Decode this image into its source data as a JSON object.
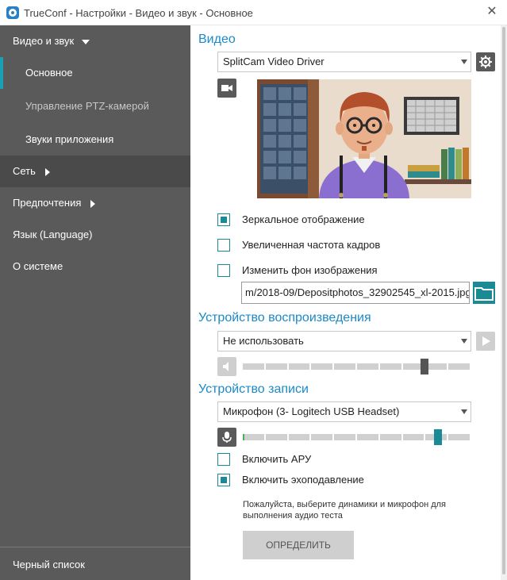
{
  "window": {
    "title": "TrueConf - Настройки - Видео и звук - Основное",
    "close_label": "✕"
  },
  "sidebar": {
    "items": [
      {
        "label": "Видео и звук"
      },
      {
        "label": "Основное"
      },
      {
        "label": "Управление PTZ-камерой"
      },
      {
        "label": "Звуки приложения"
      },
      {
        "label": "Сеть"
      },
      {
        "label": "Предпочтения"
      },
      {
        "label": "Язык (Language)"
      },
      {
        "label": "О системе"
      }
    ],
    "footer_item": "Черный список"
  },
  "video": {
    "title": "Видео",
    "device": "SplitCam Video Driver",
    "mirror_label": "Зеркальное отображение",
    "mirror_checked": true,
    "framerate_label": "Увеличенная частота кадров",
    "framerate_checked": false,
    "background_label": "Изменить фон изображения",
    "background_checked": false,
    "background_path": "m/2018-09/Depositphotos_32902545_xl-2015.jpg"
  },
  "playback": {
    "title": "Устройство воспроизведения",
    "device": "Не использовать",
    "volume_level": 0.8
  },
  "recording": {
    "title": "Устройство записи",
    "device": "Микрофон (3- Logitech USB Headset)",
    "level": 0.86,
    "agc_label": "Включить АРУ",
    "agc_checked": false,
    "echo_label": "Включить эхоподавление",
    "echo_checked": true
  },
  "test": {
    "hint": "Пожалуйста, выберите динамики и микрофон для выполнения аудио теста",
    "button_label": "ОПРЕДЕЛИТЬ"
  },
  "colors": {
    "accent": "#1a8ac8",
    "teal": "#1a8a94",
    "sidebar": "#5a5a5a"
  }
}
